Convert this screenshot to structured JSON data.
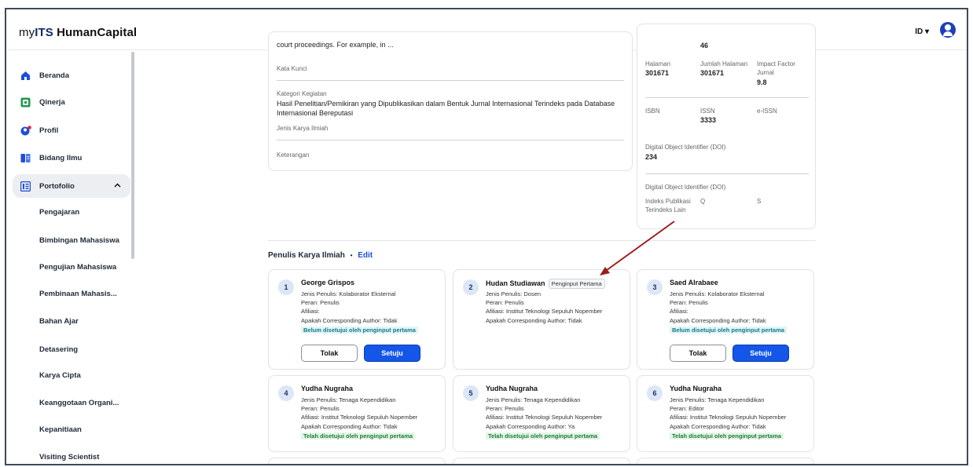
{
  "brand": {
    "prefix": "my",
    "its": "ITS",
    "suffix": " HumanCapital"
  },
  "header": {
    "lang": "ID ▾"
  },
  "sidebar": {
    "items": [
      {
        "label": "Beranda",
        "icon": "home-icon"
      },
      {
        "label": "Qinerja",
        "icon": "qinerja-icon"
      },
      {
        "label": "Profil",
        "icon": "profile-icon"
      },
      {
        "label": "Bidang Ilmu",
        "icon": "book-icon"
      },
      {
        "label": "Portofolio",
        "icon": "portfolio-icon"
      }
    ],
    "subitems": [
      "Pengajaran",
      "Bimbingan Mahasiswa",
      "Pengujian Mahasiswa",
      "Pembinaan Mahasis...",
      "Bahan Ajar",
      "Detasering",
      "Karya Cipta",
      "Keanggotaan Organi...",
      "Kepanitiaan",
      "Visiting Scientist"
    ],
    "expand_icon": "chevron-up-icon"
  },
  "detail": {
    "abstract_tail": "court proceedings. For example, in ...",
    "kata_kunci_label": "Kata Kunci",
    "kategori_label": "Kategori Kegiatan",
    "kategori_value_1": "Hasil Penelitian/Pemikiran yang Dipublikasikan dalam Bentuk Jurnal Internasional Terindeks pada Database",
    "kategori_value_2": "Internasional Bereputasi",
    "jenis_label": "Jenis Karya Ilmiah",
    "keterangan_label": "Keterangan"
  },
  "meta": {
    "top_value": "46",
    "halaman_label": "Halaman",
    "halaman_value": "301671",
    "jumlah_label": "Jumlah Halaman",
    "jumlah_value": "301671",
    "impact_label_1": "Impact Factor",
    "impact_label_2": "Jurnal",
    "impact_value": "9.8",
    "isbn_label": "ISBN",
    "issn_label": "ISSN",
    "issn_value": "3333",
    "eissn_label": "e-ISSN",
    "doi_label": "Digital Object Identifier (DOI)",
    "doi_value": "234",
    "doi2_label": "Digital Object Identifier (DOI)",
    "indeks_label_1": "Indeks Publikasi",
    "indeks_label_2": "Terindeks Lain",
    "q_label": "Q",
    "s_label": "S"
  },
  "authors_section": {
    "title": "Penulis Karya Ilmiah",
    "dot": "•",
    "edit": "Edit"
  },
  "authors": [
    {
      "no": "1",
      "name": "George Grispos",
      "tag": "",
      "jenis": "Jenis Penulis: Kolaborator Eksternal",
      "peran": "Peran: Penulis",
      "afiliasi": "Afiliasi:",
      "corr": "Apakah Corresponding Author: Tidak",
      "status": "Belum disetujui oleh penginput pertama",
      "tolak": "Tolak",
      "setuju": "Setuju"
    },
    {
      "no": "2",
      "name": "Hudan Studiawan",
      "tag": "Penginput Pertama",
      "jenis": "Jenis Penulis: Dosen",
      "peran": "Peran: Penulis",
      "afiliasi": "Afiliasi: Institut Teknologi Sepuluh Nopember",
      "corr": "Apakah Corresponding Author: Tidak"
    },
    {
      "no": "3",
      "name": "Saed Alrabaee",
      "tag": "",
      "jenis": "Jenis Penulis: Kolaborator Eksternal",
      "peran": "Peran: Penulis",
      "afiliasi": "Afiliasi:",
      "corr": "Apakah Corresponding Author: Tidak",
      "status": "Belum disetujui oleh penginput pertama",
      "tolak": "Tolak",
      "setuju": "Setuju"
    },
    {
      "no": "4",
      "name": "Yudha Nugraha",
      "jenis": "Jenis Penulis: Tenaga Kependidikan",
      "peran": "Peran: Penulis",
      "afiliasi": "Afiliasi: Institut Teknologi Sepuluh Nopember",
      "corr": "Apakah Corresponding Author: Tidak",
      "status": "Telah disetujui oleh penginput pertama"
    },
    {
      "no": "5",
      "name": "Yudha Nugraha",
      "jenis": "Jenis Penulis: Tenaga Kependidikan",
      "peran": "Peran: Penulis",
      "afiliasi": "Afiliasi: Institut Teknologi Sepuluh Nopember",
      "corr": "Apakah Corresponding Author: Ya",
      "status": "Telah disetujui oleh penginput pertama"
    },
    {
      "no": "6",
      "name": "Yudha Nugraha",
      "jenis": "Jenis Penulis: Tenaga Kependidikan",
      "peran": "Peran: Editor",
      "afiliasi": "Afiliasi: Institut Teknologi Sepuluh Nopember",
      "corr": "Apakah Corresponding Author: Tidak",
      "status": "Telah disetujui oleh penginput pertama"
    }
  ],
  "colors": {
    "primary": "#1456e8",
    "pending_text": "#0f7b8a",
    "approved_text": "#1e7a35",
    "annotation_arrow": "#9b1c1c"
  }
}
